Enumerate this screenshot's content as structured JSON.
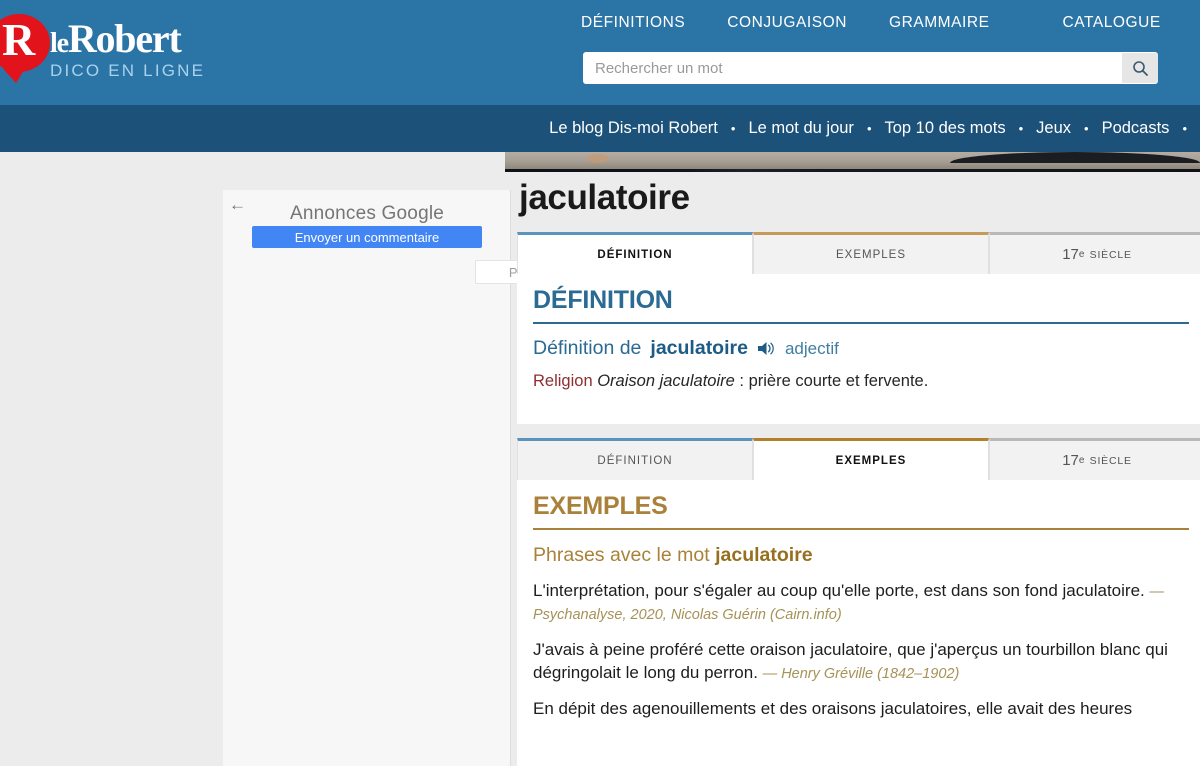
{
  "site": {
    "logo_main_le": "le",
    "logo_main_robert": "Robert",
    "logo_sub": "DICO EN LIGNE",
    "logo_letter": "R"
  },
  "header": {
    "nav": [
      {
        "label": "DÉFINITIONS"
      },
      {
        "label": "CONJUGAISON"
      },
      {
        "label": "GRAMMAIRE"
      },
      {
        "label": "CATALOGUE"
      }
    ],
    "search": {
      "placeholder": "Rechercher un mot",
      "value": "",
      "icon": "search-icon"
    }
  },
  "subnav": {
    "items": [
      {
        "label": "Le blog Dis-moi Robert"
      },
      {
        "label": "Le mot du jour"
      },
      {
        "label": "Top 10 des mots"
      },
      {
        "label": "Jeux"
      },
      {
        "label": "Podcasts"
      }
    ],
    "separator": "•"
  },
  "ads": {
    "back_icon": "←",
    "title": "Annonces Google",
    "primary_button": "Envoyer un commentaire",
    "secondary_button": "Pourquoi cette annonce ?",
    "secondary_icon": "▷",
    "primary_color": "#4285f4"
  },
  "article": {
    "word": "jaculatoire",
    "tabs_definition": [
      {
        "label": "DÉFINITION",
        "active": true,
        "accent": "#5b93bd"
      },
      {
        "label": "EXEMPLES",
        "active": false,
        "accent": "#c69a5a"
      },
      {
        "label": "17e SIÈCLE",
        "active": false,
        "accent": "#b9b9b9"
      }
    ],
    "tabs_examples": [
      {
        "label": "DÉFINITION",
        "active": false,
        "accent": "#5b93bd"
      },
      {
        "label": "EXEMPLES",
        "active": true,
        "accent": "#b27f2b"
      },
      {
        "label": "17e SIÈCLE",
        "active": false,
        "accent": "#b9b9b9"
      }
    ],
    "tab_17_number": "17",
    "tab_17_sup": "e",
    "tab_17_word": "SIÈCLE",
    "definition": {
      "heading": "DÉFINITION",
      "intro_prefix": "Définition de",
      "word": "jaculatoire",
      "audio_icon": "speaker-icon",
      "part_of_speech": "adjectif",
      "domain": "Religion",
      "phrase": "Oraison jaculatoire",
      "separator": " : ",
      "gloss": "prière courte et fervente."
    },
    "examples": {
      "heading": "EXEMPLES",
      "subheading_prefix": "Phrases avec le mot",
      "subheading_word": "jaculatoire",
      "items": [
        {
          "text": "L'interprétation, pour s'égaler au coup qu'elle porte, est dans son fond jaculatoire.",
          "citation": "— Psychanalyse, 2020, Nicolas Guérin (Cairn.info)"
        },
        {
          "text": "J'avais à peine proféré cette oraison jaculatoire, que j'aperçus un tourbillon blanc qui dégringolait le long du perron.",
          "citation": "— Henry Gréville (1842–1902)"
        },
        {
          "text": "En dépit des agenouillements et des oraisons jaculatoires, elle avait des heures",
          "citation": ""
        }
      ]
    }
  },
  "colors": {
    "header_blue": "#2b74a6",
    "subnav_blue": "#1c5179",
    "logo_red": "#e2131a",
    "accent_blue": "#2a6a93",
    "accent_gold": "#a9813a",
    "domain_red": "#8c2f2f",
    "page_bg": "#ececec"
  }
}
